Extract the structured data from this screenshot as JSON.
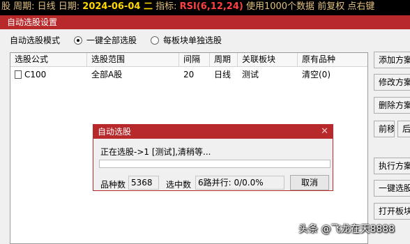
{
  "status_bar": {
    "prefix": "股 周期: 日线 日期: ",
    "date": "2024-06-04 二",
    "indicator_label": " 指标: ",
    "indicator": "RSI(6,12,24)",
    "suffix": " 使用1000个数据 前复权 点右键"
  },
  "dialog": {
    "title": "自动选股设置",
    "mode_label": "自动选股模式",
    "mode_options": [
      "一键全部选股",
      "每板块单独选股"
    ],
    "mode_selected": "一键全部选股"
  },
  "table": {
    "headers": [
      "选股公式",
      "选股范围",
      "间隔",
      "周期",
      "关联板块",
      "原有品种"
    ],
    "rows": [
      {
        "formula": "C100",
        "range": "全部A股",
        "interval": "20",
        "period": "日线",
        "sector": "测试",
        "original": "清空(0)"
      }
    ]
  },
  "side_buttons": [
    "添加方案",
    "修改方案",
    "删除方案",
    "前移",
    "后移",
    "执行方案",
    "一键选股",
    "打开板块"
  ],
  "progress_dialog": {
    "title": "自动选股",
    "close_glyph": "✕",
    "message": "正在选股->1 [测试],清稍等...",
    "progress": 0.0,
    "count_label": "品种数",
    "count_value": "5368",
    "selected_label": "选中数",
    "selected_value": "6路并行: 0/0.0%",
    "cancel_label": "取消"
  },
  "watermark": "头条 @飞龙在天8888",
  "colors": {
    "accent": "#b8292c",
    "status_bg": "#000000",
    "progress": "#3a8ee6"
  }
}
